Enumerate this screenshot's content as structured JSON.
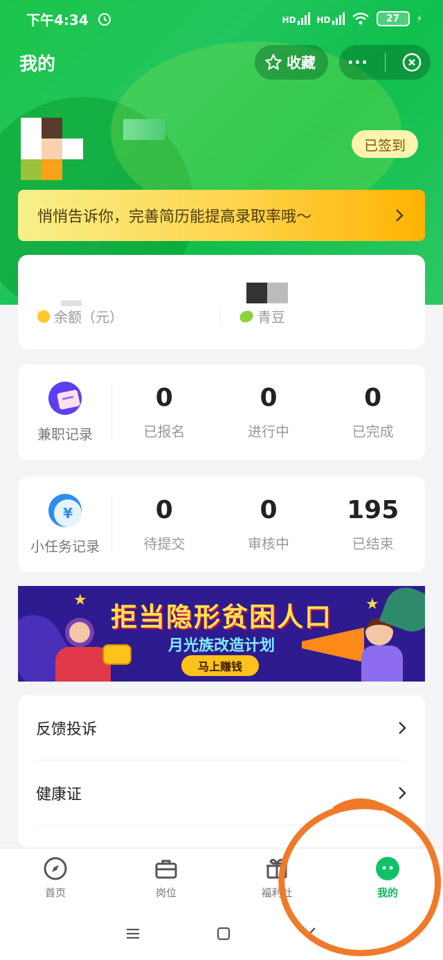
{
  "status_bar": {
    "time": "下午4:34",
    "battery": "27"
  },
  "header": {
    "title": "我的",
    "favorite_label": "收藏",
    "more_label": "···"
  },
  "profile": {
    "signin_label": "已签到"
  },
  "tip_banner": {
    "text": "悄悄告诉你，完善简历能提高录取率哦～"
  },
  "wallet": {
    "balance_label": "余额（元）",
    "beans_label": "青豆"
  },
  "part_time": {
    "title": "兼职记录",
    "stats": [
      {
        "value": "0",
        "label": "已报名"
      },
      {
        "value": "0",
        "label": "进行中"
      },
      {
        "value": "0",
        "label": "已完成"
      }
    ]
  },
  "tasks": {
    "title": "小任务记录",
    "stats": [
      {
        "value": "0",
        "label": "待提交"
      },
      {
        "value": "0",
        "label": "审核中"
      },
      {
        "value": "195",
        "label": "已结束"
      }
    ]
  },
  "ad_banner": {
    "title": "拒当隐形贫困人口",
    "subtitle": "月光族改造计划",
    "button": "马上赚钱"
  },
  "menu": [
    {
      "label": "反馈投诉"
    },
    {
      "label": "健康证"
    }
  ],
  "tabbar": [
    {
      "label": "首页",
      "icon": "compass-icon"
    },
    {
      "label": "岗位",
      "icon": "briefcase-icon"
    },
    {
      "label": "福利社",
      "icon": "gift-icon"
    },
    {
      "label": "我的",
      "icon": "smile-icon",
      "active": true
    }
  ],
  "colors": {
    "brand_green": "#1bc54a",
    "accent_yellow": "#ffc72c",
    "annotation_orange": "#f07a2a"
  }
}
